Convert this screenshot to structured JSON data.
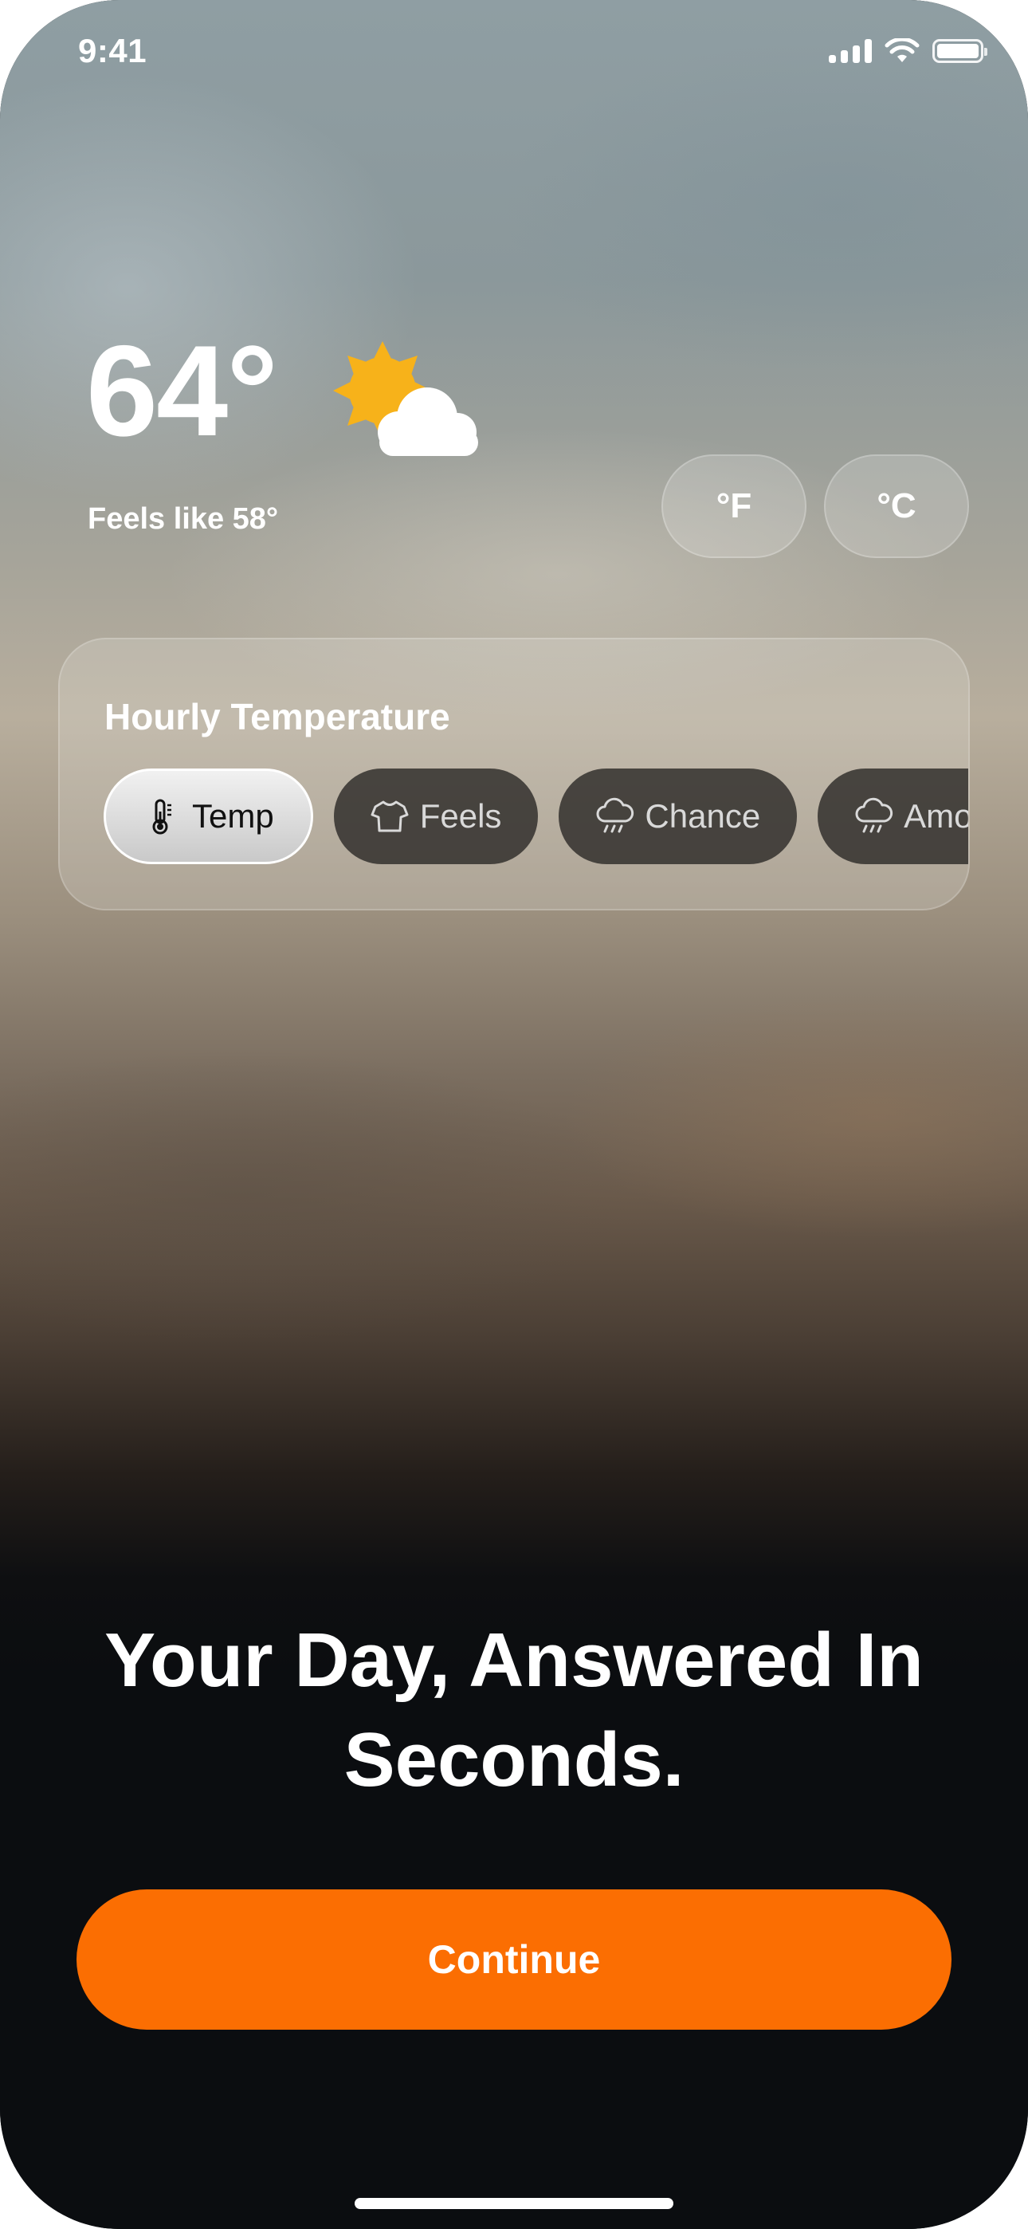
{
  "status_bar": {
    "time": "9:41",
    "icons": [
      "cellular-signal-icon",
      "wifi-icon",
      "battery-icon"
    ]
  },
  "weather": {
    "temperature": "64°",
    "condition_icon": "partly-cloudy-icon",
    "feels_like": "Feels like 58°"
  },
  "units": {
    "fahrenheit": "°F",
    "celsius": "°C"
  },
  "hourly": {
    "title": "Hourly Temperature",
    "chips": [
      {
        "label": "Temp",
        "icon": "thermometer-icon",
        "active": true
      },
      {
        "label": "Feels",
        "icon": "tshirt-icon",
        "active": false
      },
      {
        "label": "Chance",
        "icon": "rain-cloud-icon",
        "active": false
      },
      {
        "label": "Amount",
        "icon": "rain-cloud-icon",
        "active": false
      }
    ]
  },
  "headline": {
    "line1": "Your Day, Answered In",
    "line2": "Seconds."
  },
  "cta": {
    "continue_label": "Continue"
  },
  "colors": {
    "accent": "#fb6e02",
    "sun": "#f7b21a",
    "background_dark": "#0b0d10"
  }
}
